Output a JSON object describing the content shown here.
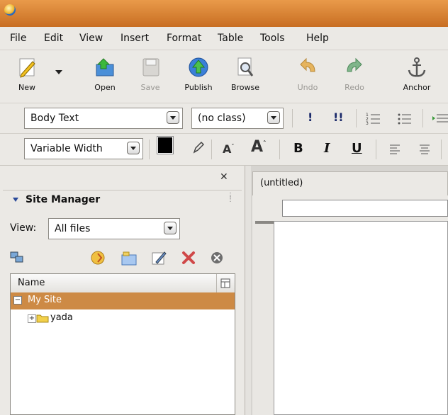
{
  "menubar": {
    "items": [
      "File",
      "Edit",
      "View",
      "Insert",
      "Format",
      "Table",
      "Tools",
      "Help"
    ]
  },
  "toolbar": {
    "buttons": [
      {
        "label": "New",
        "enabled": true,
        "icon": "new-page-icon"
      },
      {
        "label": "Open",
        "enabled": true,
        "icon": "open-folder-icon"
      },
      {
        "label": "Save",
        "enabled": false,
        "icon": "save-disk-icon"
      },
      {
        "label": "Publish",
        "enabled": true,
        "icon": "publish-globe-icon"
      },
      {
        "label": "Browse",
        "enabled": true,
        "icon": "browse-magnifier-icon"
      },
      {
        "label": "Undo",
        "enabled": false,
        "icon": "undo-arrow-icon"
      },
      {
        "label": "Redo",
        "enabled": false,
        "icon": "redo-arrow-icon"
      },
      {
        "label": "Anchor",
        "enabled": true,
        "icon": "anchor-icon"
      }
    ]
  },
  "format_toolbar": {
    "paragraph_style": "Body Text",
    "class_select": "(no class)",
    "font_select": "Variable Width"
  },
  "site_manager": {
    "title": "Site Manager",
    "view_label": "View:",
    "view_value": "All files",
    "column_header": "Name",
    "tree": [
      {
        "label": "My Site",
        "selected": true,
        "expand": "−"
      },
      {
        "label": "yada",
        "selected": false,
        "expand": "+"
      }
    ]
  },
  "editor": {
    "tab_title": "(untitled)"
  },
  "colors": {
    "title_bar": "#d9822f",
    "selection": "#cd8a45"
  }
}
